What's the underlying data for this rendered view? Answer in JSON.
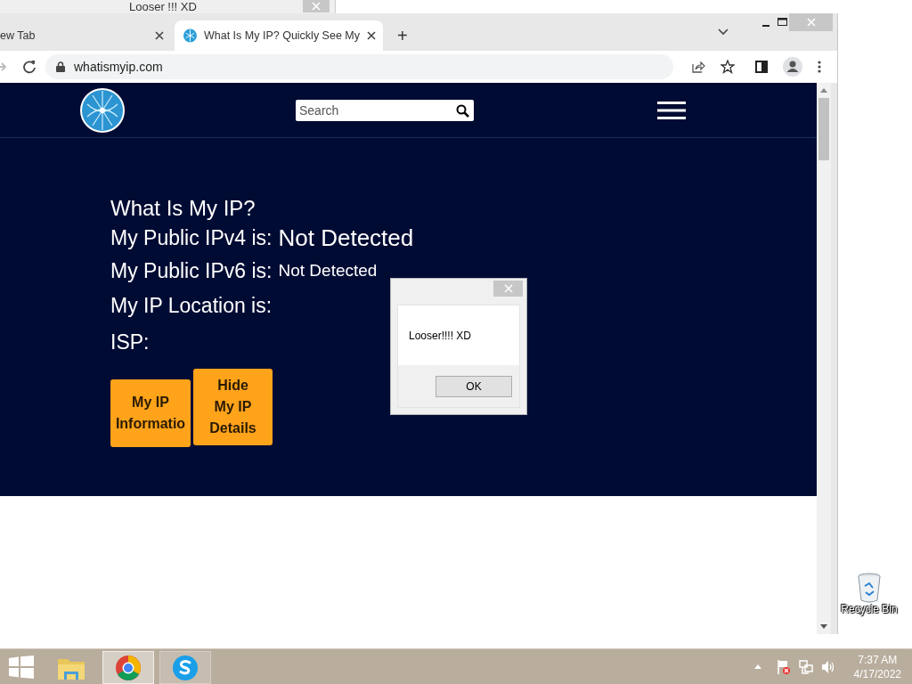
{
  "background_window": {
    "title": "Looser !!! XD"
  },
  "browser": {
    "tabs": [
      {
        "title": "ew Tab",
        "selected": false
      },
      {
        "title": "What Is My IP? Quickly See My",
        "selected": true
      }
    ],
    "new_tab_label": "+",
    "address": "whatismyip.com",
    "page": {
      "search": {
        "placeholder": "Search"
      },
      "heading": "What Is My IP?",
      "rows": [
        {
          "label": "My Public IPv4 is:",
          "value": "Not Detected",
          "kind": "large"
        },
        {
          "label": "My Public IPv6 is:",
          "value": "Not Detected",
          "kind": "small"
        },
        {
          "label": "My IP Location is:",
          "kind": "plain"
        },
        {
          "label": "ISP:",
          "kind": "plain"
        }
      ],
      "buttons": [
        "My IP Informatio",
        "Hide My IP Details"
      ]
    }
  },
  "dialog": {
    "message": "Looser!!!! XD",
    "button": "OK"
  },
  "desktop_icons": [
    {
      "label": "Recycle Bin"
    }
  ],
  "taskbar": {
    "apps": [
      {
        "kind": "explorer",
        "running": false,
        "selected": false
      },
      {
        "kind": "chrome",
        "running": true,
        "selected": true
      },
      {
        "kind": "skype",
        "running": true,
        "selected": false
      }
    ],
    "clock": {
      "time": "7:37 AM",
      "date": "4/17/2022"
    }
  }
}
